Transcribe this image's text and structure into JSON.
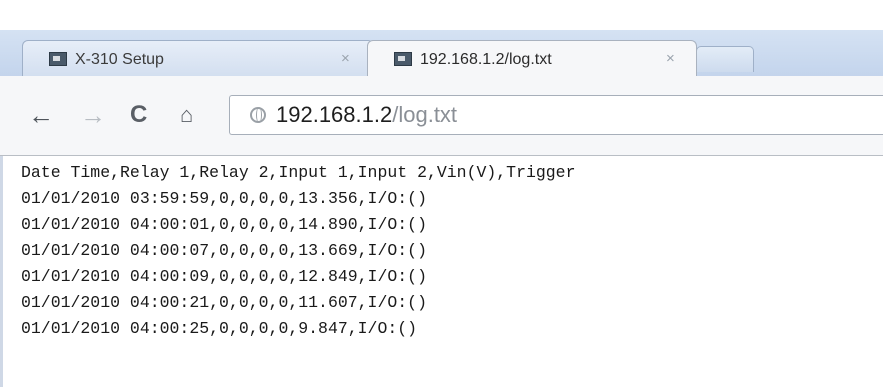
{
  "browser": {
    "tabs": [
      {
        "title": "X-310 Setup",
        "active": false
      },
      {
        "title": "192.168.1.2/log.txt",
        "active": true
      }
    ],
    "close_glyph": "×",
    "nav": {
      "back_icon": "←",
      "forward_icon": "→",
      "reload_icon": "C",
      "home_icon": "⌂"
    },
    "address": {
      "host": "192.168.1.2",
      "path": "/log.txt"
    }
  },
  "log": {
    "lines": [
      "Date Time,Relay 1,Relay 2,Input 1,Input 2,Vin(V),Trigger",
      "01/01/2010 03:59:59,0,0,0,0,13.356,I/O:()",
      "01/01/2010 04:00:01,0,0,0,0,14.890,I/O:()",
      "01/01/2010 04:00:07,0,0,0,0,13.669,I/O:()",
      "01/01/2010 04:00:09,0,0,0,0,12.849,I/O:()",
      "01/01/2010 04:00:21,0,0,0,0,11.607,I/O:()",
      "01/01/2010 04:00:25,0,0,0,0,9.847,I/O:()"
    ]
  }
}
